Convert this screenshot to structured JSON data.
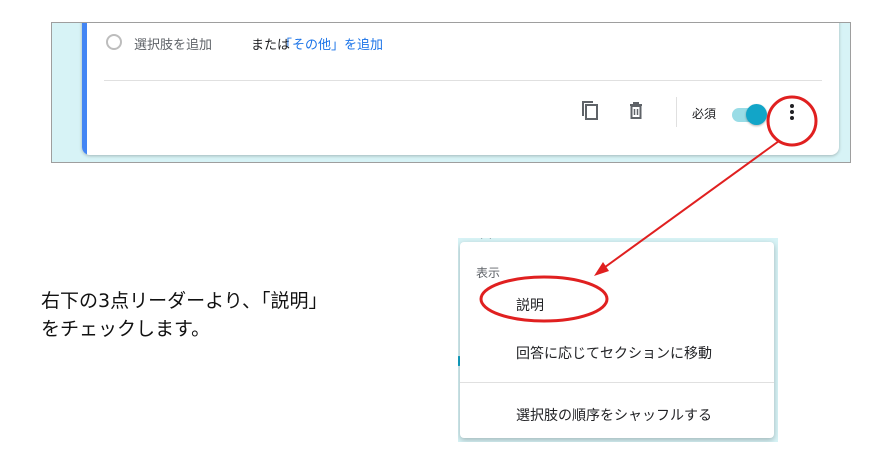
{
  "question_card": {
    "add_option": "選択肢を追加",
    "or": "または",
    "add_other": "「その他」を追加",
    "required_label": "必須",
    "required_on": true,
    "icons": [
      "copy-icon",
      "trash-icon",
      "more-vert-icon"
    ],
    "accent_color": "#4285f4",
    "toggle_color": "#12a5c8"
  },
  "instruction": {
    "line1": "右下の3点リーダーより、「説明」",
    "line2": "をチェックします。"
  },
  "menu": {
    "header": "表示",
    "items": [
      {
        "label": "説明"
      },
      {
        "label": "回答に応じてセクションに移動"
      },
      {
        "label": "選択肢の順序をシャッフルする"
      }
    ]
  },
  "annotation_color": "#e02020"
}
